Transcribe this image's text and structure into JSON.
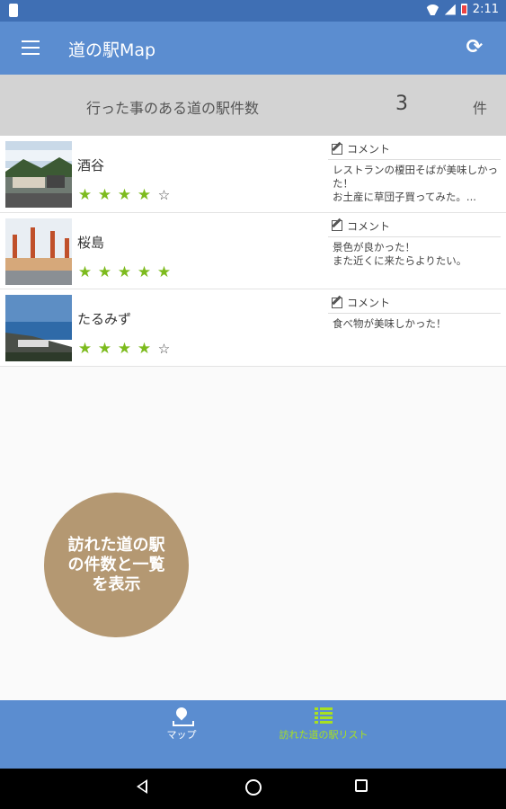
{
  "status_bar": {
    "time": "2:11"
  },
  "app_bar": {
    "title": "道の駅Map"
  },
  "visit_count": {
    "label": "行った事のある道の駅件数",
    "value": "3",
    "unit": "件"
  },
  "stations": [
    {
      "name": "酒谷",
      "rating": 4,
      "max_rating": 5,
      "comment_header": "コメント",
      "comment": "レストランの榎田そばが美味しかった！\nお土産に草団子買ってみた。..."
    },
    {
      "name": "桜島",
      "rating": 5,
      "max_rating": 5,
      "comment_header": "コメント",
      "comment": "景色が良かった！\nまた近くに来たらよりたい。"
    },
    {
      "name": "たるみず",
      "rating": 4,
      "max_rating": 5,
      "comment_header": "コメント",
      "comment": "食べ物が美味しかった！"
    }
  ],
  "callout": {
    "text": "訪れた道の駅\nの件数と一覧\nを表示"
  },
  "bottom_nav": {
    "items": [
      {
        "label": "マップ",
        "icon": "map-pin-icon",
        "active": false
      },
      {
        "label": "訪れた道の駅リスト",
        "icon": "list-icon",
        "active": true
      }
    ],
    "active_color": "#a8e020"
  },
  "colors": {
    "primary": "#5b8dd0",
    "status_bar": "#3f6fb4",
    "star": "#7dbb1e",
    "callout": "#b49872"
  }
}
